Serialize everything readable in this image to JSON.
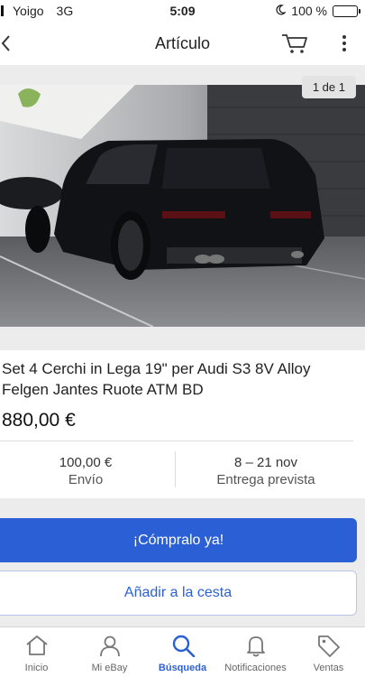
{
  "status_bar": {
    "carrier": "Yoigo",
    "network": "3G",
    "time": "5:09",
    "battery_text": "100 %",
    "battery_level": 1.0
  },
  "nav": {
    "title": "Artículo",
    "back_icon": "chevron-left-icon",
    "cart_icon": "cart-icon",
    "more_icon": "more-vertical-icon"
  },
  "gallery": {
    "counter": "1 de 1"
  },
  "item": {
    "title": "Set 4 Cerchi in Lega 19\" per Audi S3 8V Alloy Felgen Jantes Ruote ATM BD",
    "price": "880,00 €",
    "shipping_cost": "100,00 €",
    "shipping_label": "Envío",
    "delivery_dates": "8 – 21 nov",
    "delivery_label": "Entrega prevista"
  },
  "actions": {
    "buy_now": "¡Cómpralo ya!",
    "add_to_cart": "Añadir a la cesta"
  },
  "tabs": [
    {
      "label": "Inicio",
      "icon": "home-icon",
      "active": false
    },
    {
      "label": "Mi eBay",
      "icon": "user-icon",
      "active": false
    },
    {
      "label": "Búsqueda",
      "icon": "search-icon",
      "active": true
    },
    {
      "label": "Notificaciones",
      "icon": "bell-icon",
      "active": false
    },
    {
      "label": "Ventas",
      "icon": "tag-icon",
      "active": false
    }
  ],
  "colors": {
    "accent": "#2a5fd6",
    "background": "#ececec"
  }
}
